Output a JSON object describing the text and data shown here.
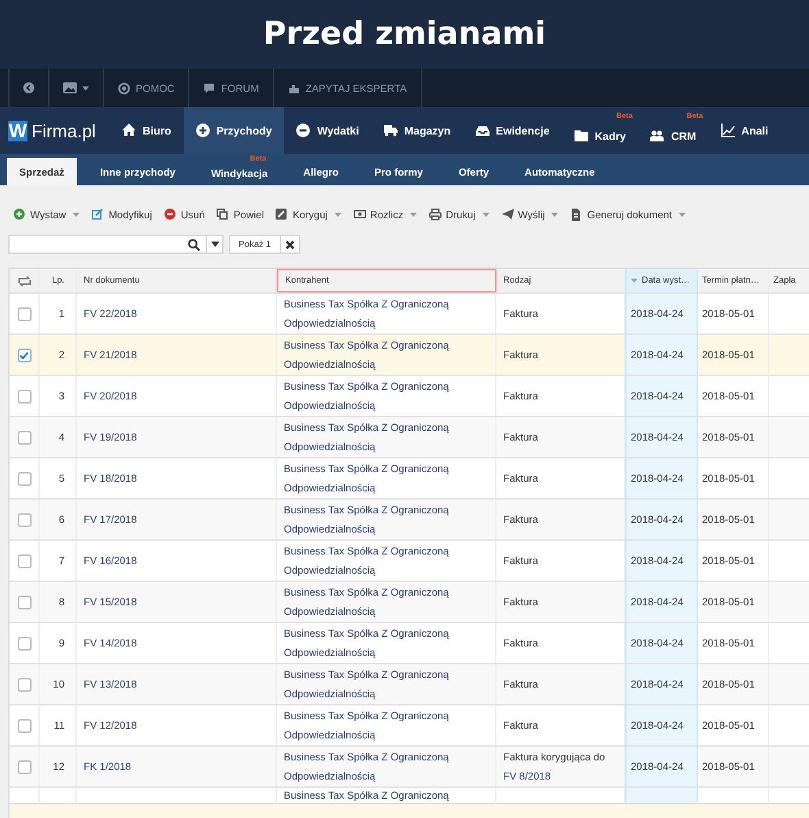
{
  "title": "Przed zmianami",
  "top_bar": {
    "links": [
      {
        "label": "POMOC"
      },
      {
        "label": "FORUM"
      },
      {
        "label": "ZAPYTAJ EKSPERTA"
      }
    ]
  },
  "logo": {
    "mark": "W",
    "text": "Firma.pl"
  },
  "nav": [
    {
      "label": "Biuro",
      "selected": false
    },
    {
      "label": "Przychody",
      "selected": true
    },
    {
      "label": "Wydatki",
      "selected": false
    },
    {
      "label": "Magazyn",
      "selected": false
    },
    {
      "label": "Ewidencje",
      "selected": false
    },
    {
      "label": "Kadry",
      "selected": false,
      "badge": "Beta"
    },
    {
      "label": "CRM",
      "selected": false,
      "badge": "Beta"
    },
    {
      "label": "Anali",
      "selected": false
    }
  ],
  "subtabs": [
    {
      "label": "Sprzedaż",
      "selected": true
    },
    {
      "label": "Inne przychody",
      "selected": false
    },
    {
      "label": "Windykacja",
      "selected": false,
      "badge": "Beta"
    },
    {
      "label": "Allegro",
      "selected": false
    },
    {
      "label": "Pro formy",
      "selected": false
    },
    {
      "label": "Oferty",
      "selected": false
    },
    {
      "label": "Automatyczne",
      "selected": false
    }
  ],
  "toolbar": [
    {
      "label": "Wystaw",
      "dropdown": true
    },
    {
      "label": "Modyfikuj",
      "dropdown": false
    },
    {
      "label": "Usuń",
      "dropdown": false
    },
    {
      "label": "Powiel",
      "dropdown": false
    },
    {
      "label": "Koryguj",
      "dropdown": true
    },
    {
      "label": "Rozlicz",
      "dropdown": true
    },
    {
      "label": "Drukuj",
      "dropdown": true
    },
    {
      "label": "Wyślij",
      "dropdown": true
    },
    {
      "label": "Generuj dokument",
      "dropdown": true
    }
  ],
  "filter": {
    "show_button": "Pokaż 1"
  },
  "table": {
    "columns": [
      {
        "label": "Lp.",
        "sorted": false,
        "highlighted": false
      },
      {
        "label": "Nr dokumentu",
        "sorted": false,
        "highlighted": false
      },
      {
        "label": "Kontrahent",
        "sorted": false,
        "highlighted": true
      },
      {
        "label": "Rodzaj",
        "sorted": false,
        "highlighted": false
      },
      {
        "label": "Data wyst…",
        "sorted": true,
        "highlighted": false
      },
      {
        "label": "Termin płatn…",
        "sorted": false,
        "highlighted": false
      },
      {
        "label": "Zapła",
        "sorted": false,
        "highlighted": false
      }
    ],
    "rows": [
      {
        "lp": "1",
        "number": "FV 22/2018",
        "contractor": "Business Tax Spółka Z Ograniczoną Odpowiedzialnością",
        "type": "Faktura",
        "issue_date": "2018-04-24",
        "due_date": "2018-05-01",
        "checked": false,
        "selected": false
      },
      {
        "lp": "2",
        "number": "FV 21/2018",
        "contractor": "Business Tax Spółka Z Ograniczoną Odpowiedzialnością",
        "type": "Faktura",
        "issue_date": "2018-04-24",
        "due_date": "2018-05-01",
        "checked": true,
        "selected": true
      },
      {
        "lp": "3",
        "number": "FV 20/2018",
        "contractor": "Business Tax Spółka Z Ograniczoną Odpowiedzialnością",
        "type": "Faktura",
        "issue_date": "2018-04-24",
        "due_date": "2018-05-01",
        "checked": false,
        "selected": false
      },
      {
        "lp": "4",
        "number": "FV 19/2018",
        "contractor": "Business Tax Spółka Z Ograniczoną Odpowiedzialnością",
        "type": "Faktura",
        "issue_date": "2018-04-24",
        "due_date": "2018-05-01",
        "checked": false,
        "selected": false
      },
      {
        "lp": "5",
        "number": "FV 18/2018",
        "contractor": "Business Tax Spółka Z Ograniczoną Odpowiedzialnością",
        "type": "Faktura",
        "issue_date": "2018-04-24",
        "due_date": "2018-05-01",
        "checked": false,
        "selected": false
      },
      {
        "lp": "6",
        "number": "FV 17/2018",
        "contractor": "Business Tax Spółka Z Ograniczoną Odpowiedzialnością",
        "type": "Faktura",
        "issue_date": "2018-04-24",
        "due_date": "2018-05-01",
        "checked": false,
        "selected": false
      },
      {
        "lp": "7",
        "number": "FV 16/2018",
        "contractor": "Business Tax Spółka Z Ograniczoną Odpowiedzialnością",
        "type": "Faktura",
        "issue_date": "2018-04-24",
        "due_date": "2018-05-01",
        "checked": false,
        "selected": false
      },
      {
        "lp": "8",
        "number": "FV 15/2018",
        "contractor": "Business Tax Spółka Z Ograniczoną Odpowiedzialnością",
        "type": "Faktura",
        "issue_date": "2018-04-24",
        "due_date": "2018-05-01",
        "checked": false,
        "selected": false
      },
      {
        "lp": "9",
        "number": "FV 14/2018",
        "contractor": "Business Tax Spółka Z Ograniczoną Odpowiedzialnością",
        "type": "Faktura",
        "issue_date": "2018-04-24",
        "due_date": "2018-05-01",
        "checked": false,
        "selected": false
      },
      {
        "lp": "10",
        "number": "FV 13/2018",
        "contractor": "Business Tax Spółka Z Ograniczoną Odpowiedzialnością",
        "type": "Faktura",
        "issue_date": "2018-04-24",
        "due_date": "2018-05-01",
        "checked": false,
        "selected": false
      },
      {
        "lp": "11",
        "number": "FV 12/2018",
        "contractor": "Business Tax Spółka Z Ograniczoną Odpowiedzialnością",
        "type": "Faktura",
        "issue_date": "2018-04-24",
        "due_date": "2018-05-01",
        "checked": false,
        "selected": false
      },
      {
        "lp": "12",
        "number": "FK 1/2018",
        "contractor": "Business Tax Spółka Z Ograniczoną Odpowiedzialnością",
        "type": "Faktura korygująca do",
        "type_link": "FV 8/2018",
        "issue_date": "2018-04-24",
        "due_date": "2018-05-01",
        "checked": false,
        "selected": false
      }
    ],
    "partial_row": {
      "contractor": "Business Tax Spółka Z Ograniczoną"
    }
  }
}
